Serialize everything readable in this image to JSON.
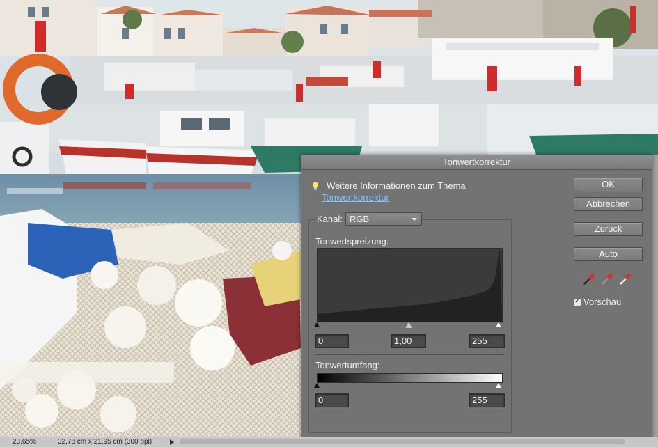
{
  "dialog": {
    "title": "Tonwertkorrektur",
    "info_text": "Weitere Informationen zum Thema",
    "info_link": "Tonwertkorrektur",
    "channel_label": "Kanal:",
    "channel_value": "RGB",
    "input_levels_label": "Tonwertspreizung:",
    "input_black": "0",
    "input_gamma": "1,00",
    "input_white": "255",
    "output_levels_label": "Tonwertumfang:",
    "output_black": "0",
    "output_white": "255",
    "buttons": {
      "ok": "OK",
      "cancel": "Abbrechen",
      "reset": "Zurück",
      "auto": "Auto"
    },
    "preview_label": "Vorschau",
    "preview_checked": true
  },
  "statusbar": {
    "zoom": "23,65%",
    "doc_info": "32,78 cm x 21,95 cm (300 ppi)"
  },
  "colors": {
    "dialog_bg": "#737373",
    "field_bg": "#4a4a4a",
    "link": "#7ec3ff",
    "histogram_bg": "#333333"
  }
}
